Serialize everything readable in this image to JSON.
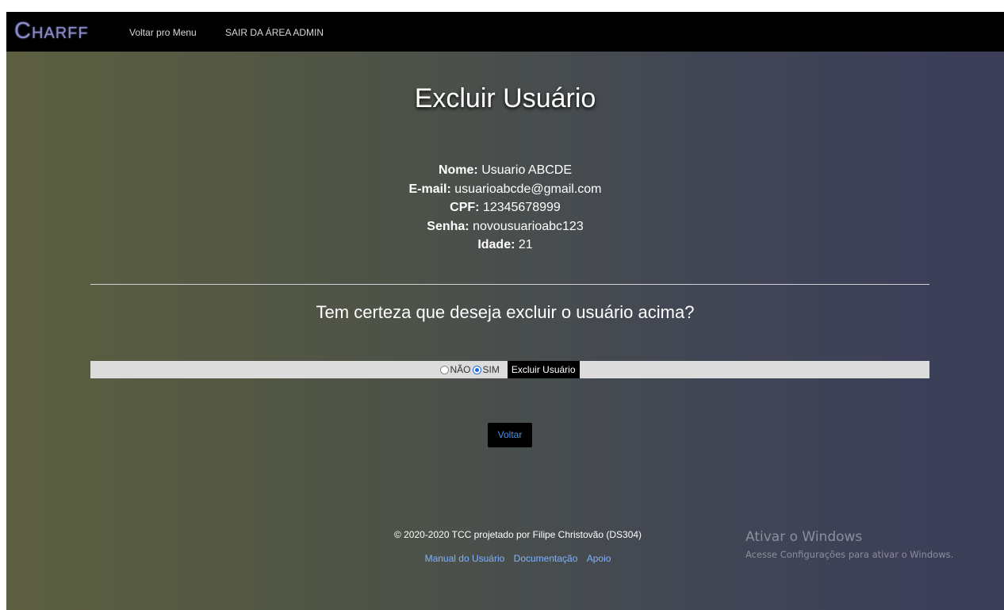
{
  "navbar": {
    "brand": "Charff",
    "links": [
      "Voltar pro Menu",
      "SAIR DA ÁREA ADMIN"
    ]
  },
  "page": {
    "title": "Excluir Usuário",
    "fields": [
      {
        "label": "Nome:",
        "value": "Usuario ABCDE"
      },
      {
        "label": "E-mail:",
        "value": "usuarioabcde@gmail.com"
      },
      {
        "label": "CPF:",
        "value": "12345678999"
      },
      {
        "label": "Senha:",
        "value": "novousuarioabc123"
      },
      {
        "label": "Idade:",
        "value": "21"
      }
    ],
    "question": "Tem certeza que deseja excluir o usuário acima?"
  },
  "form": {
    "option_no": "NÃO",
    "option_yes": "SIM",
    "selected": "SIM",
    "submit_label": "Excluir Usuário"
  },
  "back_button": "Voltar",
  "footer": {
    "copyright": "© 2020-2020 TCC projetado por Filipe Christovão (DS304)",
    "links": [
      "Manual do Usuário",
      "Documentação",
      "Apoio"
    ]
  },
  "windows_watermark": {
    "title": "Ativar o Windows",
    "subtitle": "Acesse Configurações para ativar o Windows."
  },
  "colors": {
    "navbar_bg": "#000000",
    "brand": "#8b8dc6",
    "link_blue": "#7fb2ff"
  }
}
